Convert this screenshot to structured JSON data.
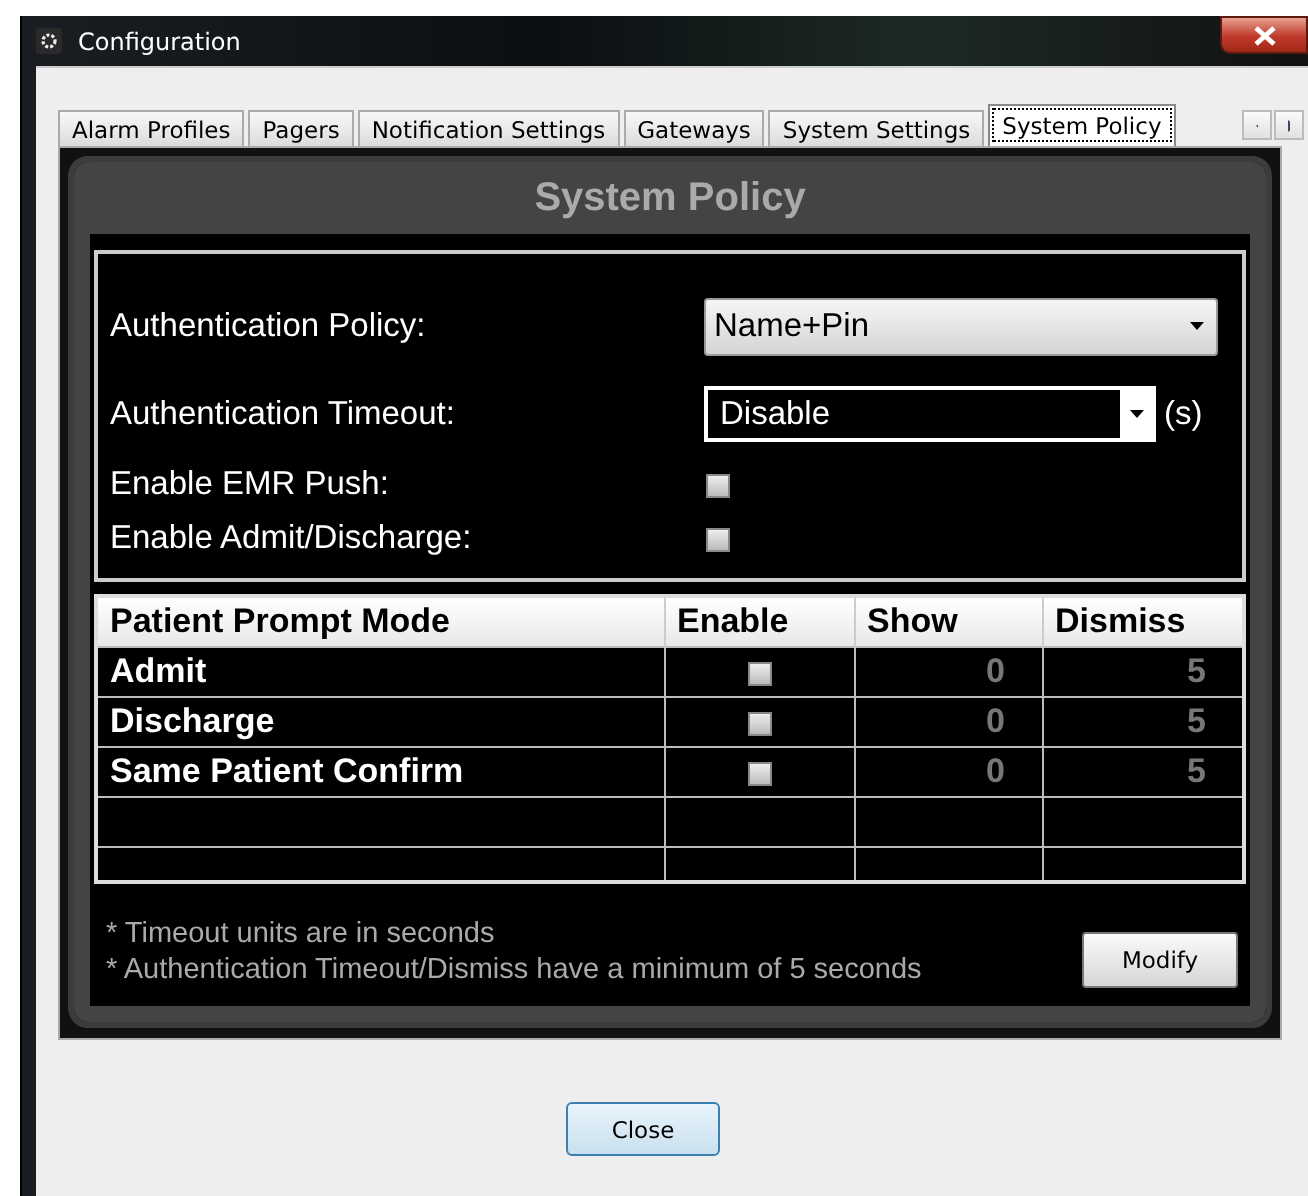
{
  "window": {
    "title": "Configuration"
  },
  "tabs": [
    {
      "label": "Alarm Profiles",
      "selected": false
    },
    {
      "label": "Pagers",
      "selected": false
    },
    {
      "label": "Notification Settings",
      "selected": false
    },
    {
      "label": "Gateways",
      "selected": false
    },
    {
      "label": "System Settings",
      "selected": false
    },
    {
      "label": "System Policy",
      "selected": true
    }
  ],
  "panel": {
    "title": "System Policy"
  },
  "settings": [
    {
      "kind": "dropdown",
      "label": "Authentication Policy:",
      "value": "Name+Pin"
    },
    {
      "kind": "combo",
      "label": "Authentication Timeout:",
      "value": "Disable",
      "unit": "(s)"
    },
    {
      "kind": "checkbox",
      "label": "Enable EMR Push:",
      "checked": false
    },
    {
      "kind": "checkbox",
      "label": "Enable Admit/Discharge:",
      "checked": false
    }
  ],
  "table": {
    "columns": [
      "Patient Prompt Mode",
      "Enable",
      "Show",
      "Dismiss"
    ],
    "rows": [
      {
        "mode": "Admit",
        "enabled": false,
        "show": "0",
        "dismiss": "5"
      },
      {
        "mode": "Discharge",
        "enabled": false,
        "show": "0",
        "dismiss": "5"
      },
      {
        "mode": "Same Patient Confirm",
        "enabled": false,
        "show": "0",
        "dismiss": "5"
      }
    ]
  },
  "notes": [
    "* Timeout units are in seconds",
    "* Authentication Timeout/Dismiss have a minimum of 5 seconds"
  ],
  "modify_button": "Modify",
  "close_button": "Close"
}
